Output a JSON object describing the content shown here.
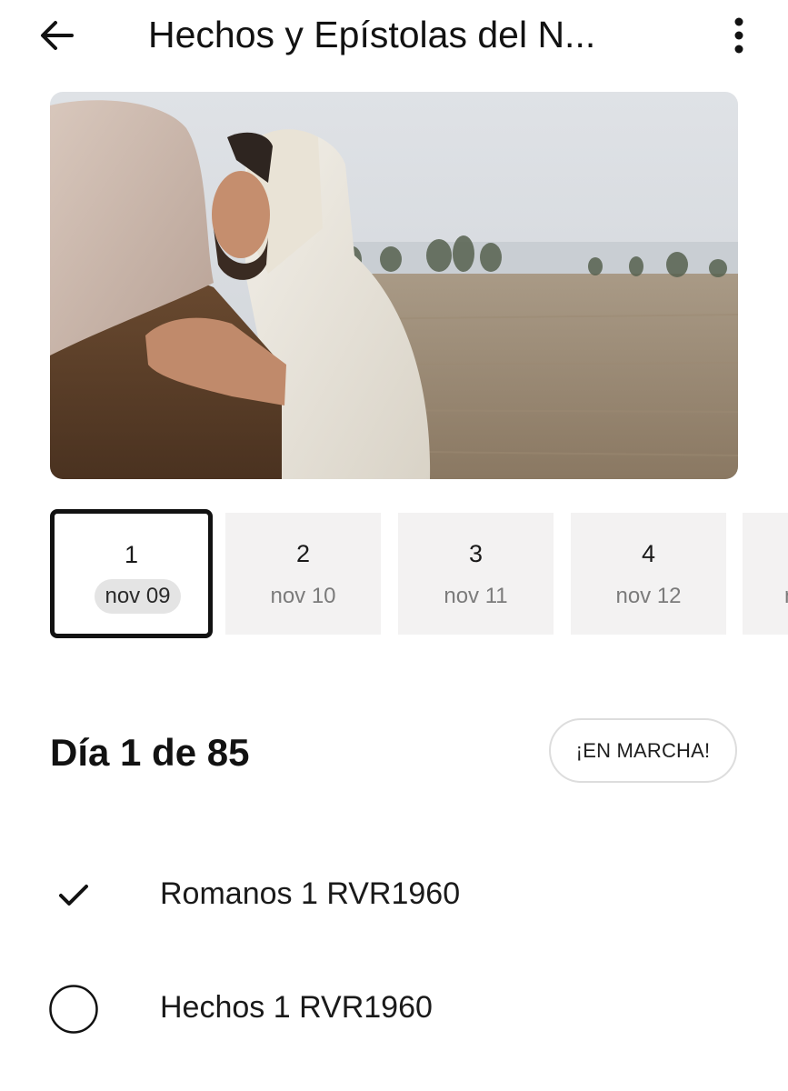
{
  "header": {
    "title": "Hechos y Epístolas del N...",
    "back_icon": "arrow-left-icon",
    "menu_icon": "more-vertical-icon"
  },
  "hero": {
    "image_desc_icon": "plan-cover-image"
  },
  "days": [
    {
      "number": "1",
      "date": "nov 09",
      "selected": true
    },
    {
      "number": "2",
      "date": "nov 10",
      "selected": false
    },
    {
      "number": "3",
      "date": "nov 11",
      "selected": false
    },
    {
      "number": "4",
      "date": "nov 12",
      "selected": false
    },
    {
      "number": "",
      "date": "n",
      "selected": false
    }
  ],
  "progress": {
    "heading": "Día 1 de 85",
    "status_button": "¡EN MARCHA!"
  },
  "readings": [
    {
      "label": "Romanos 1 RVR1960",
      "completed": true,
      "icon": "checkmark-icon"
    },
    {
      "label": "Hechos 1 RVR1960",
      "completed": false,
      "icon": "empty-circle-icon"
    }
  ],
  "colors": {
    "text": "#121212",
    "card_bg": "#f3f2f2",
    "selected_border": "#121212",
    "muted_text": "#7b7b7b"
  }
}
